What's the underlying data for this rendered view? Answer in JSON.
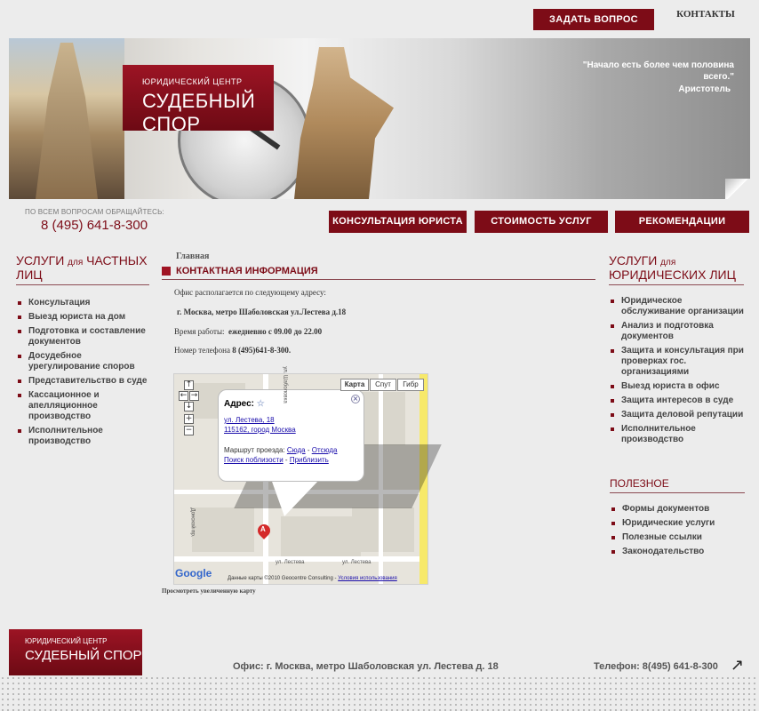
{
  "top": {
    "ask_button": "ЗАДАТЬ ВОПРОС",
    "contacts_link": "КОНТАКТЫ"
  },
  "header": {
    "logo_small": "ЮРИДИЧЕСКИЙ ЦЕНТР",
    "logo_big": "СУДЕБНЫЙ СПОР",
    "quote": "\"Начало есть более чем половина всего.\"",
    "quote_author": "Аристотель"
  },
  "contact": {
    "label": "ПО ВСЕМ ВОПРОСАМ ОБРАЩАЙТЕСЬ:",
    "phone": "8 (495) 641-8-300"
  },
  "nav": {
    "consult": "КОНСУЛЬТАЦИЯ ЮРИСТА",
    "prices": "СТОИМОСТЬ УСЛУГ",
    "recommend": "РЕКОМЕНДАЦИИ"
  },
  "left_sidebar": {
    "title_main": "УСЛУГИ",
    "title_small": "для",
    "title_rest": "ЧАСТНЫХ ЛИЦ",
    "items": [
      "Консультация",
      "Выезд юриста на дом",
      "Подготовка и составление документов",
      "Досудебное урегулирование споров",
      "Представительство в суде",
      "Кассационное и апелляционное производство",
      "Исполнительное производство"
    ]
  },
  "main": {
    "breadcrumb": "Главная",
    "section_title": "КОНТАКТНАЯ ИНФОРМАЦИЯ",
    "office_intro": "Офис располагается по следующему адресу:",
    "address": "г. Москва, метро Шаболовская ул.Лестева д.18",
    "hours_label": "Время работы:",
    "hours_value": "ежедневно с 09.00 до 22.00",
    "phone_label": "Номер телефона",
    "phone_value": "8 (495)641-8-300.",
    "view_larger": "Просмотреть увеличенную карту"
  },
  "map": {
    "type_buttons": [
      "Карта",
      "Спут",
      "Гибр"
    ],
    "popup_title": "Адрес:",
    "popup_street": "ул. Лестева, 18",
    "popup_city": "115162, город Москва",
    "route_label": "Маршрут проезда:",
    "route_to": "Сюда",
    "route_from": "Отсюда",
    "search_nearby": "Поиск поблизости",
    "zoom_in_link": "Приблизить",
    "copyright": "Данные карты ©2010 Geocentre Consulting",
    "terms": "Условия использования",
    "google": "Google",
    "marker": "A",
    "streets": [
      "ул. Лестева",
      "ул. Лестева",
      "Донской пр.",
      "ул. Шаболовка"
    ]
  },
  "right_sidebar": {
    "title_main": "УСЛУГИ",
    "title_small": "для",
    "title_rest": "ЮРИДИЧЕСКИХ ЛИЦ",
    "items": [
      "Юридическое обслуживание организации",
      "Анализ и подготовка документов",
      "Защита и консультация при проверках гос. организациями",
      "Выезд юриста в офис",
      "Защита интересов в суде",
      "Защита деловой репутации",
      "Исполнительное производство"
    ],
    "useful_title": "ПОЛЕЗНОЕ",
    "useful_items": [
      "Формы документов",
      "Юридические услуги",
      "Полезные ссылки",
      "Законодательство"
    ]
  },
  "footer": {
    "logo_small": "ЮРИДИЧЕСКИЙ ЦЕНТР",
    "logo_big": "СУДЕБНЫЙ СПОР",
    "office": "Офис: г. Москва, метро Шаболовская ул. Лестева д. 18",
    "phone": "Телефон: 8(495) 641-8-300"
  }
}
